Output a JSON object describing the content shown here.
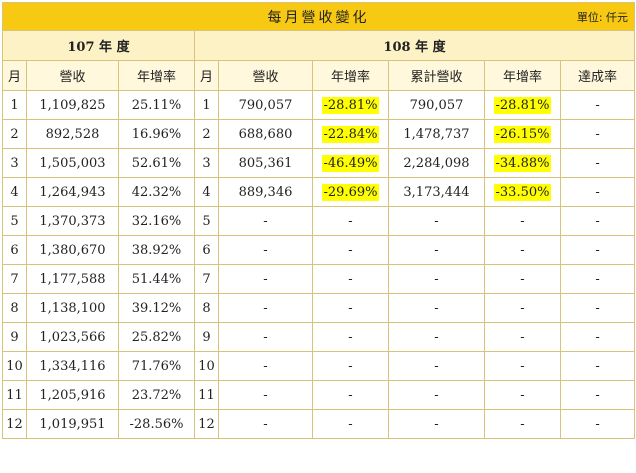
{
  "title": "每月營收變化",
  "unit": "單位: 仟元",
  "year_a": "107 年 度",
  "year_b": "108 年 度",
  "headers": {
    "month": "月",
    "revenue": "營收",
    "yoy": "年增率",
    "cum_revenue": "累計營收",
    "achievement": "達成率"
  },
  "highlight_color": "#ffff00",
  "header_color": "#f8c913",
  "rows": [
    {
      "m107": "1",
      "rev107": "1,109,825",
      "yoy107": "25.11%",
      "m108": "1",
      "rev108": "790,057",
      "yoy108": "-28.81%",
      "cum108": "790,057",
      "cumyoy108": "-28.81%",
      "ach108": "-"
    },
    {
      "m107": "2",
      "rev107": "892,528",
      "yoy107": "16.96%",
      "m108": "2",
      "rev108": "688,680",
      "yoy108": "-22.84%",
      "cum108": "1,478,737",
      "cumyoy108": "-26.15%",
      "ach108": "-"
    },
    {
      "m107": "3",
      "rev107": "1,505,003",
      "yoy107": "52.61%",
      "m108": "3",
      "rev108": "805,361",
      "yoy108": "-46.49%",
      "cum108": "2,284,098",
      "cumyoy108": "-34.88%",
      "ach108": "-"
    },
    {
      "m107": "4",
      "rev107": "1,264,943",
      "yoy107": "42.32%",
      "m108": "4",
      "rev108": "889,346",
      "yoy108": "-29.69%",
      "cum108": "3,173,444",
      "cumyoy108": "-33.50%",
      "ach108": "-"
    },
    {
      "m107": "5",
      "rev107": "1,370,373",
      "yoy107": "32.16%",
      "m108": "5",
      "rev108": "-",
      "yoy108": "-",
      "cum108": "-",
      "cumyoy108": "-",
      "ach108": "-"
    },
    {
      "m107": "6",
      "rev107": "1,380,670",
      "yoy107": "38.92%",
      "m108": "6",
      "rev108": "-",
      "yoy108": "-",
      "cum108": "-",
      "cumyoy108": "-",
      "ach108": "-"
    },
    {
      "m107": "7",
      "rev107": "1,177,588",
      "yoy107": "51.44%",
      "m108": "7",
      "rev108": "-",
      "yoy108": "-",
      "cum108": "-",
      "cumyoy108": "-",
      "ach108": "-"
    },
    {
      "m107": "8",
      "rev107": "1,138,100",
      "yoy107": "39.12%",
      "m108": "8",
      "rev108": "-",
      "yoy108": "-",
      "cum108": "-",
      "cumyoy108": "-",
      "ach108": "-"
    },
    {
      "m107": "9",
      "rev107": "1,023,566",
      "yoy107": "25.82%",
      "m108": "9",
      "rev108": "-",
      "yoy108": "-",
      "cum108": "-",
      "cumyoy108": "-",
      "ach108": "-"
    },
    {
      "m107": "10",
      "rev107": "1,334,116",
      "yoy107": "71.76%",
      "m108": "10",
      "rev108": "-",
      "yoy108": "-",
      "cum108": "-",
      "cumyoy108": "-",
      "ach108": "-"
    },
    {
      "m107": "11",
      "rev107": "1,205,916",
      "yoy107": "23.72%",
      "m108": "11",
      "rev108": "-",
      "yoy108": "-",
      "cum108": "-",
      "cumyoy108": "-",
      "ach108": "-"
    },
    {
      "m107": "12",
      "rev107": "1,019,951",
      "yoy107": "-28.56%",
      "m108": "12",
      "rev108": "-",
      "yoy108": "-",
      "cum108": "-",
      "cumyoy108": "-",
      "ach108": "-"
    }
  ]
}
